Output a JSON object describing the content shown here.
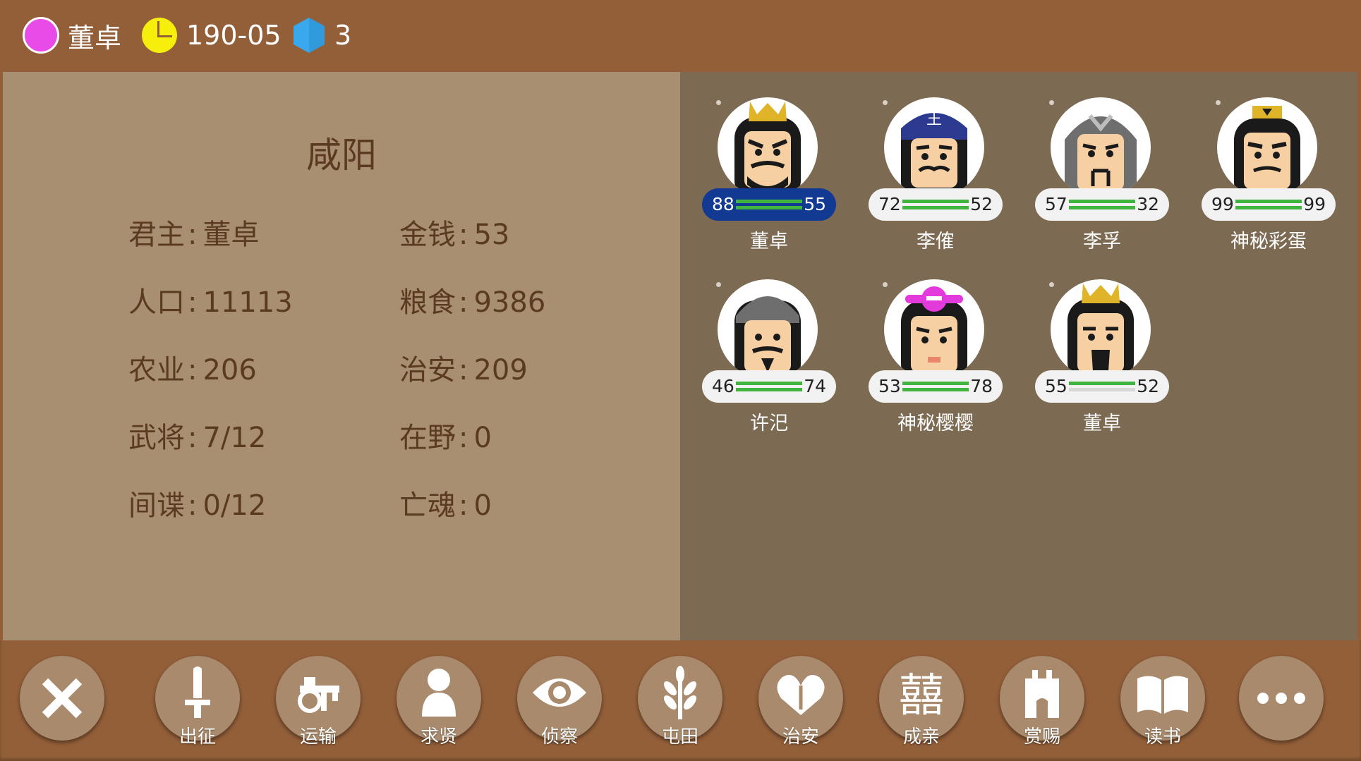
{
  "topbar": {
    "ruler": "董卓",
    "date": "190-05",
    "gems": "3",
    "faction_color": "#e94be9",
    "clock_color": "#f6ef0c",
    "gem_color": "#3aa8ec"
  },
  "city": {
    "name": "咸阳",
    "stats": [
      {
        "label": "君主",
        "value": "董卓"
      },
      {
        "label": "金钱",
        "value": "53"
      },
      {
        "label": "人口",
        "value": "11113"
      },
      {
        "label": "粮食",
        "value": "9386"
      },
      {
        "label": "农业",
        "value": "206"
      },
      {
        "label": "治安",
        "value": "209"
      },
      {
        "label": "武将",
        "value": "7/12"
      },
      {
        "label": "在野",
        "value": "0"
      },
      {
        "label": "间谍",
        "value": "0/12"
      },
      {
        "label": "亡魂",
        "value": "0"
      }
    ],
    "separator": ":"
  },
  "generals": [
    {
      "name": "董卓",
      "left": "88",
      "right": "55",
      "selected": true,
      "bar2_full": true
    },
    {
      "name": "李傕",
      "left": "72",
      "right": "52",
      "selected": false,
      "bar2_full": true
    },
    {
      "name": "李孚",
      "left": "57",
      "right": "32",
      "selected": false,
      "bar2_full": true
    },
    {
      "name": "神秘彩蛋",
      "left": "99",
      "right": "99",
      "selected": false,
      "bar2_full": true
    },
    {
      "name": "许汜",
      "left": "46",
      "right": "74",
      "selected": false,
      "bar2_full": true
    },
    {
      "name": "神秘樱樱",
      "left": "53",
      "right": "78",
      "selected": false,
      "bar2_full": true
    },
    {
      "name": "董卓",
      "left": "55",
      "right": "52",
      "selected": false,
      "bar2_full": false
    }
  ],
  "actions": [
    {
      "icon": "close-icon",
      "label": ""
    },
    {
      "icon": "sword-icon",
      "label": "出征"
    },
    {
      "icon": "cart-icon",
      "label": "运输"
    },
    {
      "icon": "person-icon",
      "label": "求贤"
    },
    {
      "icon": "eye-icon",
      "label": "侦察"
    },
    {
      "icon": "wheat-icon",
      "label": "屯田"
    },
    {
      "icon": "heart-icon",
      "label": "治安"
    },
    {
      "icon": "double-happiness-icon",
      "label": "成亲"
    },
    {
      "icon": "gate-icon",
      "label": "赏赐"
    },
    {
      "icon": "book-icon",
      "label": "读书"
    },
    {
      "icon": "more-icon",
      "label": ""
    }
  ]
}
